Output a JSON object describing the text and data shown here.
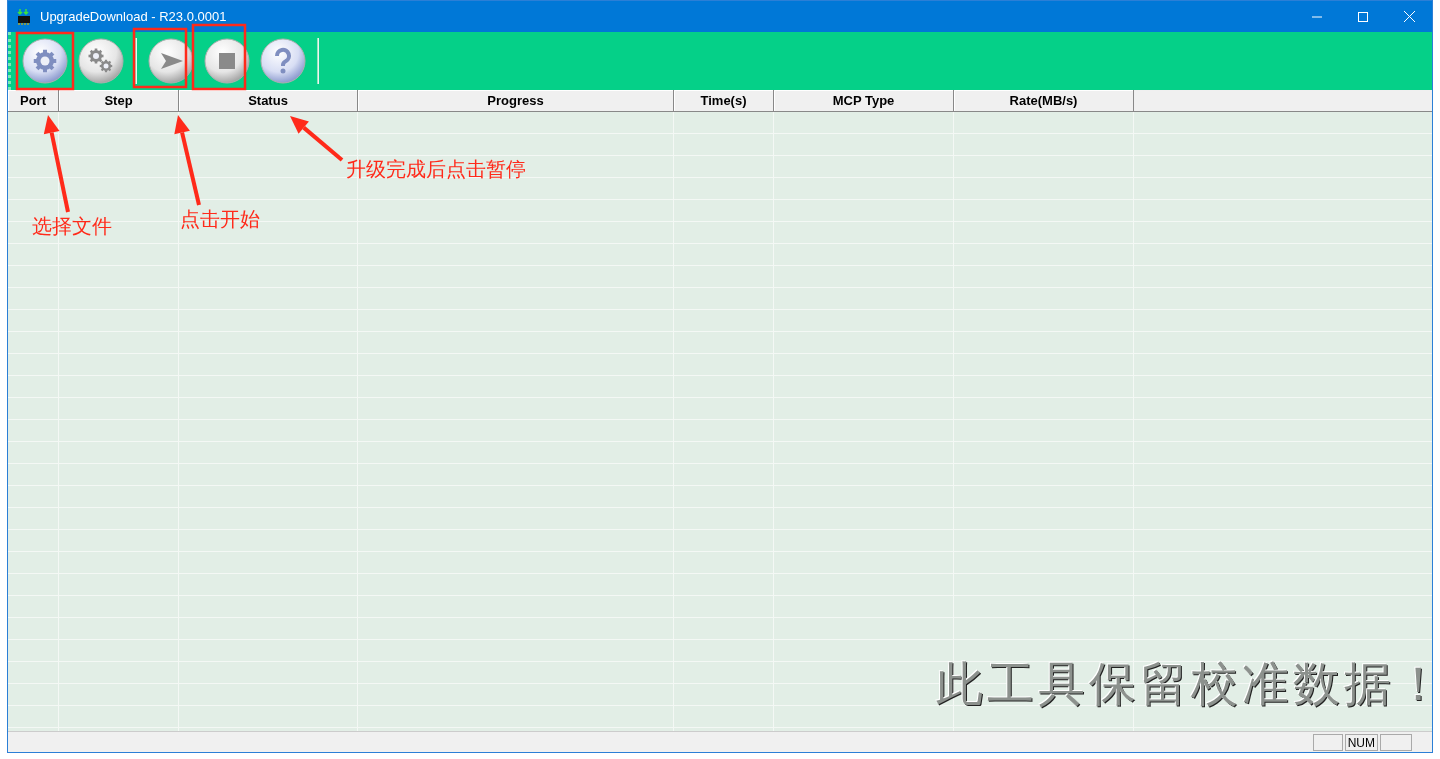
{
  "window": {
    "title": "UpgradeDownload - R23.0.0001"
  },
  "toolbar": {
    "items": [
      {
        "kind": "settings"
      },
      {
        "kind": "gears"
      },
      {
        "kind": "separator"
      },
      {
        "kind": "start"
      },
      {
        "kind": "stop"
      },
      {
        "kind": "help"
      },
      {
        "kind": "separator"
      }
    ]
  },
  "table": {
    "columns": [
      "Port",
      "Step",
      "Status",
      "Progress",
      "Time(s)",
      "MCP Type",
      "Rate(MB/s)"
    ]
  },
  "notice": "此工具保留校准数据！",
  "status_bar": {
    "indicator": "NUM"
  },
  "annotations": [
    {
      "label": "选择文件"
    },
    {
      "label": "点击开始"
    },
    {
      "label": "升级完成后点击暂停"
    }
  ]
}
